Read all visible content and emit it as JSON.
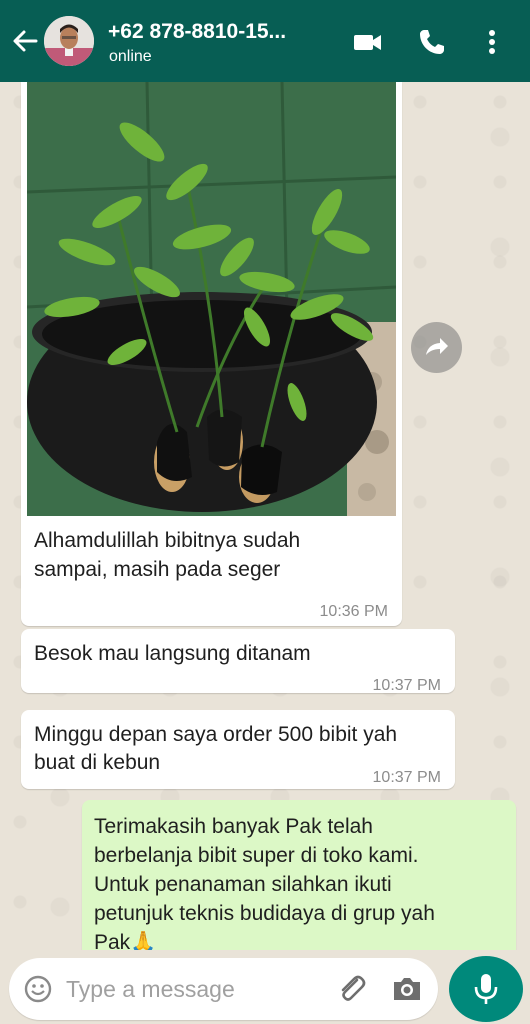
{
  "header": {
    "contact_name": "+62 878-8810-15...",
    "status": "online",
    "icons": [
      "back-arrow-icon",
      "video-call-icon",
      "phone-call-icon",
      "more-options-icon"
    ]
  },
  "messages": [
    {
      "direction": "incoming",
      "type": "image",
      "lines": [
        "Alhamdulillah bibitnya sudah",
        "sampai, masih pada seger"
      ],
      "time": "10:36 PM"
    },
    {
      "direction": "incoming",
      "type": "text",
      "lines": [
        "Besok mau langsung ditanam"
      ],
      "time": "10:37 PM"
    },
    {
      "direction": "incoming",
      "type": "text",
      "lines": [
        "Minggu depan saya order 500 bibit yah",
        "buat di kebun"
      ],
      "time": "10:37 PM"
    },
    {
      "direction": "outgoing",
      "type": "text",
      "lines": [
        "Terimakasih banyak Pak telah",
        "berbelanja bibit super di toko kami.",
        "Untuk penanaman silahkan ikuti",
        "petunjuk teknis budidaya di grup yah",
        "Pak🙏"
      ]
    }
  ],
  "composer": {
    "placeholder": "Type a message",
    "icons": [
      "emoji-icon",
      "attach-icon",
      "camera-icon",
      "microphone-icon"
    ]
  },
  "colors": {
    "header": "#075e54",
    "outgoing_bubble": "#dcf8c6",
    "incoming_bubble": "#ffffff",
    "mic_button": "#00897b",
    "chat_background": "#e9e3d8"
  }
}
